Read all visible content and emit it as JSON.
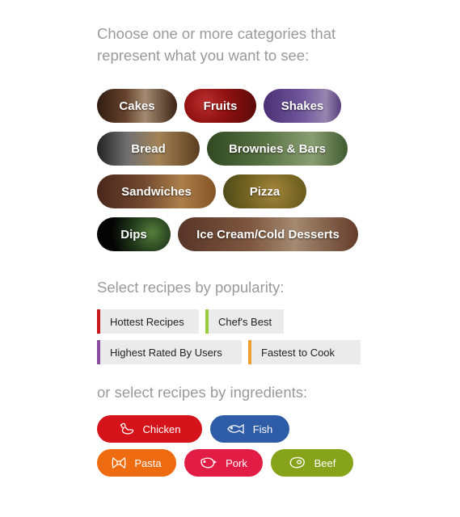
{
  "intro": "Choose one or more categories that represent what you want to see:",
  "categories": [
    {
      "label": "Cakes"
    },
    {
      "label": "Fruits"
    },
    {
      "label": "Shakes"
    },
    {
      "label": "Bread"
    },
    {
      "label": "Brownies & Bars"
    },
    {
      "label": "Sandwiches"
    },
    {
      "label": "Pizza"
    },
    {
      "label": "Dips"
    },
    {
      "label": "Ice Cream/Cold Desserts"
    }
  ],
  "popularity": {
    "heading": "Select recipes by popularity:",
    "items": [
      {
        "label": "Hottest Recipes",
        "color": "#c8161d"
      },
      {
        "label": "Chef's Best",
        "color": "#9ccc3c"
      },
      {
        "label": "Highest Rated By Users",
        "color": "#8b4c9e"
      },
      {
        "label": "Fastest to Cook",
        "color": "#f0a030"
      }
    ]
  },
  "ingredients": {
    "heading": "or select recipes by ingredients:",
    "items": [
      {
        "label": "Chicken",
        "icon": "chicken-icon",
        "color": "#d5131a"
      },
      {
        "label": "Fish",
        "icon": "fish-icon",
        "color": "#2f5ca6"
      },
      {
        "label": "Pasta",
        "icon": "pasta-icon",
        "color": "#ef6b0f"
      },
      {
        "label": "Pork",
        "icon": "pork-icon",
        "color": "#e11d45"
      },
      {
        "label": "Beef",
        "icon": "beef-icon",
        "color": "#86a31a"
      }
    ]
  }
}
